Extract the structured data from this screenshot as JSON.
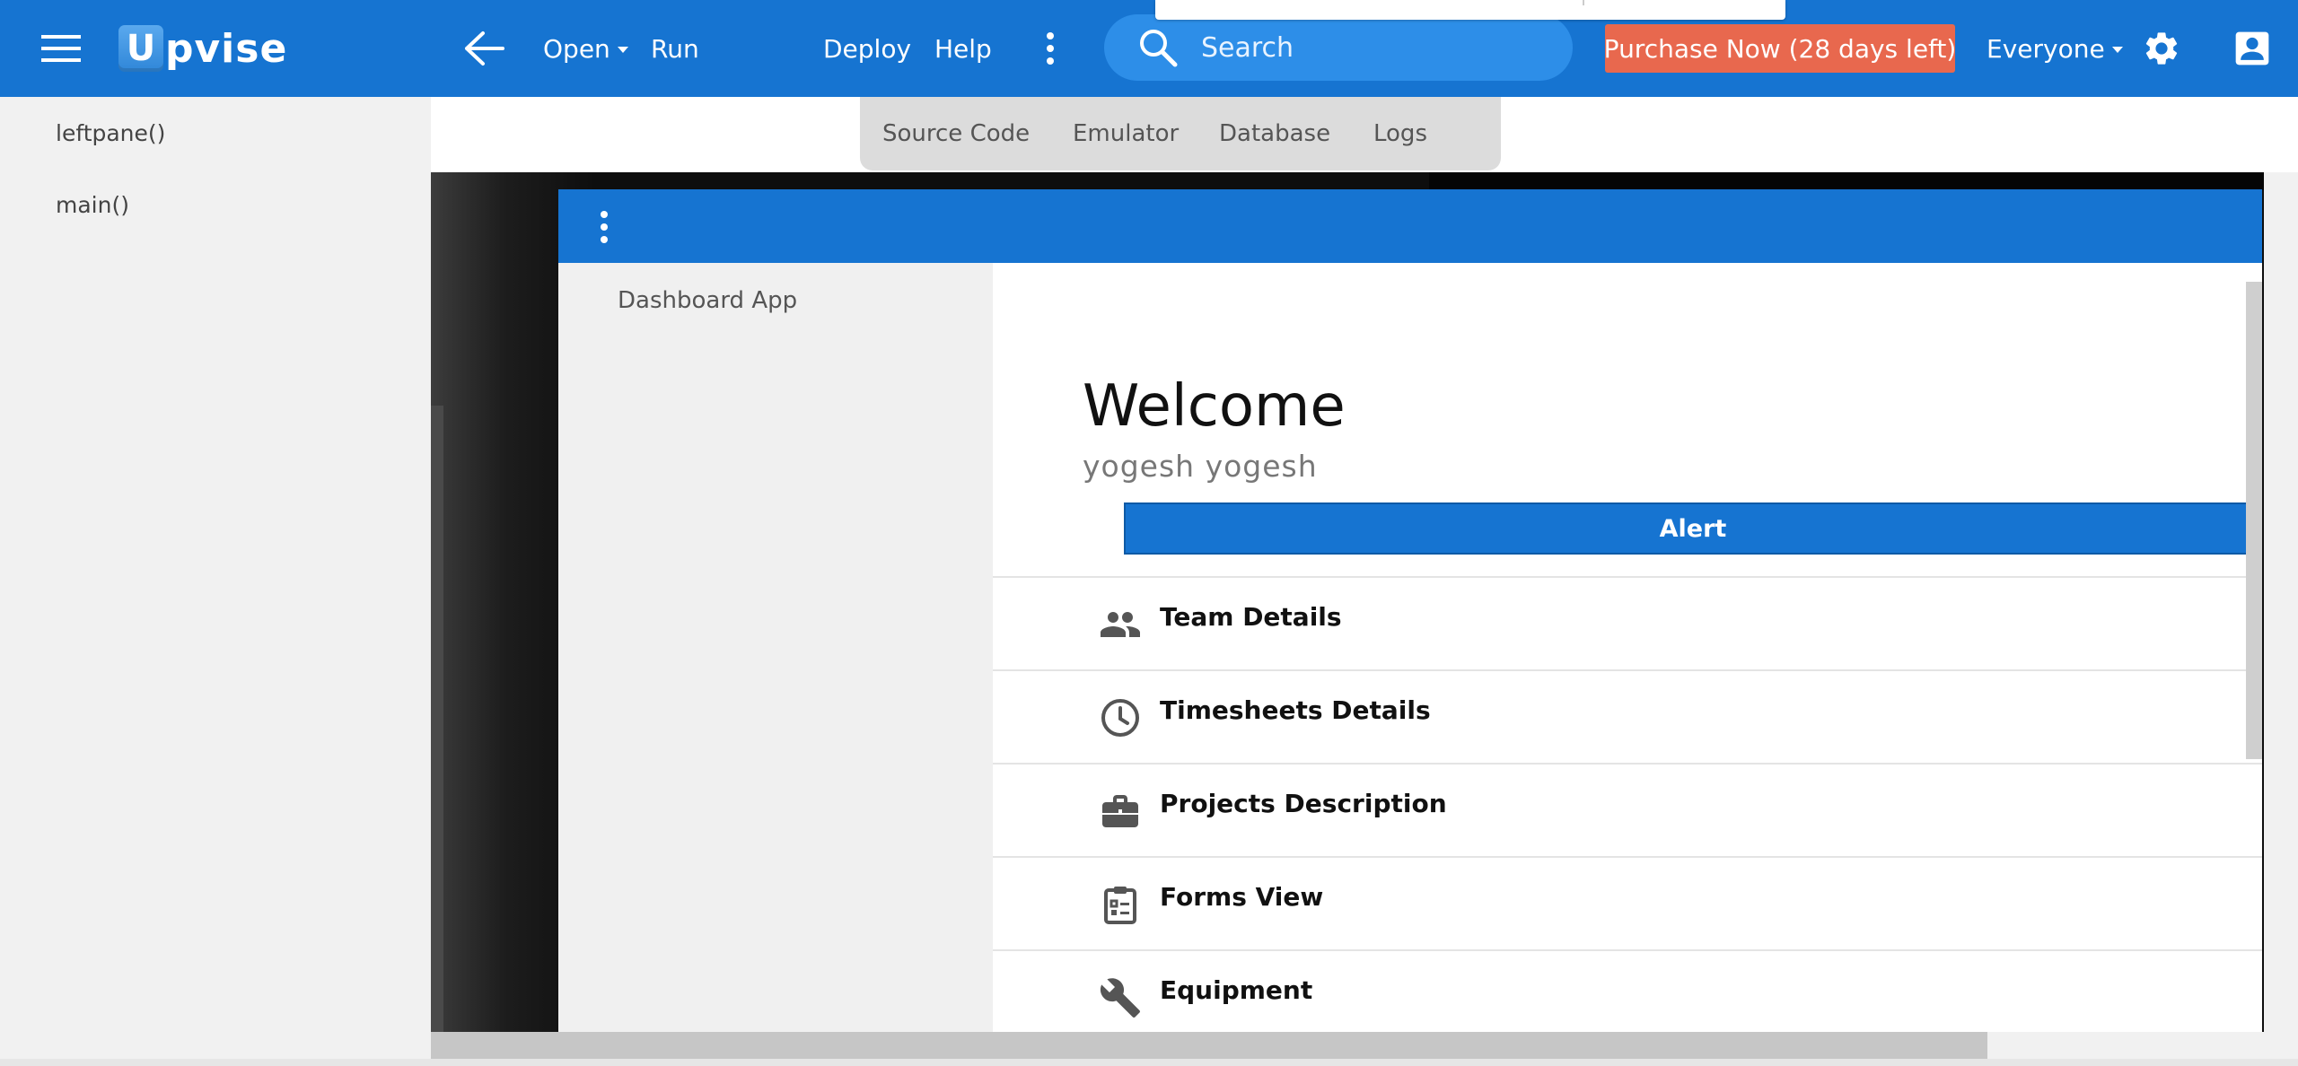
{
  "header": {
    "logo_letter": "U",
    "logo_text": "pvise",
    "nav": {
      "open": "Open",
      "run": "Run",
      "deploy": "Deploy",
      "help": "Help"
    },
    "search_label": "Search",
    "purchase": "Purchase Now (28 days left)",
    "filter": "Everyone"
  },
  "leftpane": {
    "items": [
      "leftpane()",
      "main()"
    ]
  },
  "tabs": [
    "Source Code",
    "Emulator",
    "Database",
    "Logs"
  ],
  "emulator": {
    "side_title": "Dashboard App",
    "welcome": "Welcome",
    "username": "yogesh yogesh",
    "alert_button": "Alert",
    "list": [
      {
        "label": "Team Details",
        "icon": "people-icon"
      },
      {
        "label": "Timesheets Details",
        "icon": "clock-icon"
      },
      {
        "label": "Projects Description",
        "icon": "briefcase-icon"
      },
      {
        "label": "Forms View",
        "icon": "clipboard-icon"
      },
      {
        "label": "Equipment",
        "icon": "wrench-icon"
      }
    ]
  },
  "colors": {
    "brand_blue": "#1674d1",
    "purchase": "#e8684e"
  }
}
